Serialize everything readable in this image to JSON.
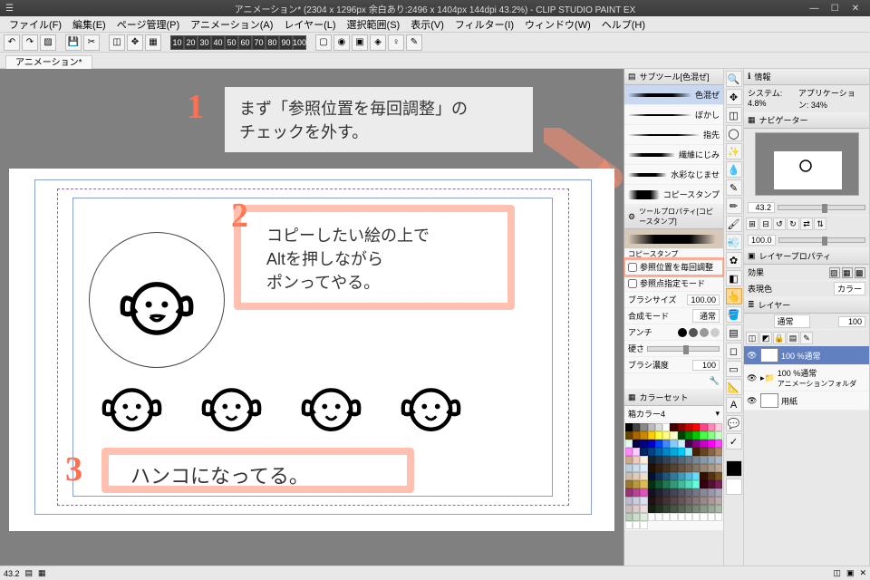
{
  "app": {
    "title": "アニメーション* (2304 x 1296px 余白あり:2496 x 1404px 144dpi 43.2%) - CLIP STUDIO PAINT EX",
    "product_short": "CLIP STUDIO PAINT EX"
  },
  "menu": [
    "ファイル(F)",
    "編集(E)",
    "ページ管理(P)",
    "アニメーション(A)",
    "レイヤー(L)",
    "選択範囲(S)",
    "表示(V)",
    "フィルター(I)",
    "ウィンドウ(W)",
    "ヘルプ(H)"
  ],
  "zoom_presets": [
    "10",
    "20",
    "30",
    "40",
    "50",
    "60",
    "70",
    "80",
    "90",
    "100"
  ],
  "doc_tab": "アニメーション*",
  "steps": {
    "one": {
      "num": "1",
      "text_line1": "まず「参照位置を毎回調整」の",
      "text_line2": "チェックを外す。"
    },
    "two": {
      "num": "2",
      "text_line1": "コピーしたい絵の上で",
      "text_line2": "Altを押しながら",
      "text_line3": "ポンってやる。"
    },
    "three": {
      "num": "3",
      "text": "ハンコになってる。"
    }
  },
  "subtool_panel": {
    "title": "サブツール[色混ぜ]",
    "items": [
      "色混ぜ",
      "ぼかし",
      "指先",
      "繊維にじみ",
      "水彩なじませ",
      "コピースタンプ"
    ]
  },
  "toolprop_panel": {
    "title": "ツールプロパティ[コピースタンプ]",
    "subtitle": "コピースタンプ",
    "opts": {
      "adjust_each": "参照位置を毎回調整",
      "ref_point_mode": "参照点指定モード"
    },
    "brush_size_label": "ブラシサイズ",
    "brush_size_value": "100.00",
    "blend_label": "合成モード",
    "blend_value": "通常",
    "anti_label": "アンチ",
    "hardness_label": "硬さ",
    "density_label": "ブラシ濃度",
    "density_value": "100"
  },
  "colorset_panel": {
    "title": "カラーセット",
    "preset": "箱カラー4"
  },
  "info_panel": {
    "title": "情報",
    "system_label": "システム:",
    "system_value": "4.8%",
    "app_label": "アプリケーション:",
    "app_value": "34%"
  },
  "navigator_panel": {
    "title": "ナビゲーター",
    "zoom": "43.2",
    "angle": "100.0"
  },
  "layerprop_panel": {
    "title": "レイヤープロパティ",
    "effect_label": "効果",
    "expr_label": "表現色",
    "expr_value": "カラー"
  },
  "layer_panel": {
    "title": "レイヤー",
    "blend": "通常",
    "opacity": "100",
    "layers": [
      {
        "name": "100 %通常",
        "sel": true
      },
      {
        "name": "100 %通常",
        "sub": "アニメーションフォルダ",
        "sel": false
      },
      {
        "name": "用紙",
        "sel": false
      }
    ]
  },
  "status": {
    "zoom": "43.2"
  }
}
